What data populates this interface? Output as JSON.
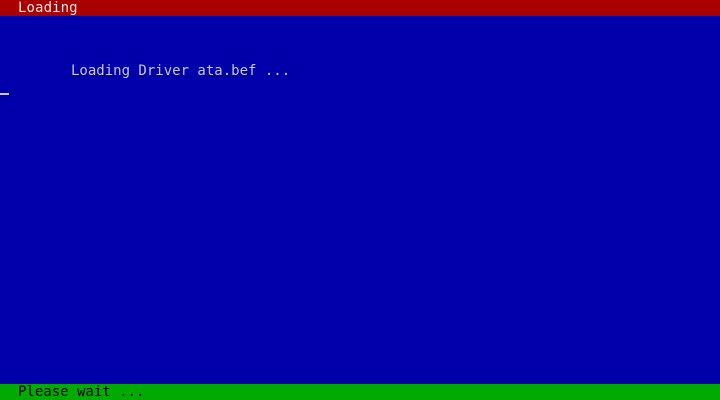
{
  "title_bar": {
    "text": "Loading",
    "background_color": "#aa0000"
  },
  "main": {
    "message": "Loading Driver ata.bef ...",
    "background_color": "#0000aa"
  },
  "status_bar": {
    "text": "Please wait ...",
    "background_color": "#00aa00"
  }
}
